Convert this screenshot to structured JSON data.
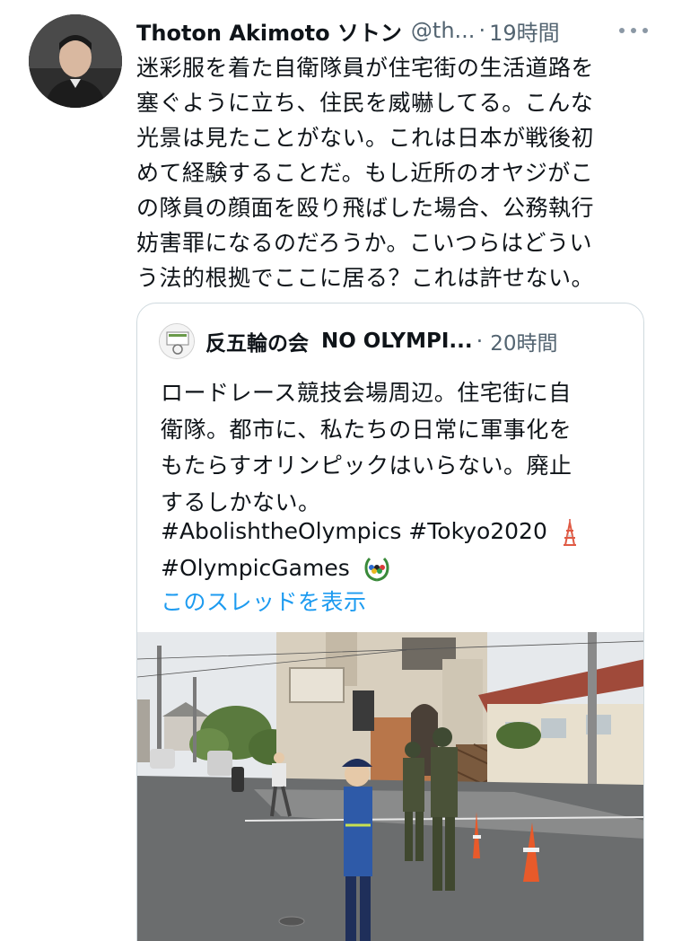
{
  "tweet": {
    "author_name": "Thoton Akimoto ソトン",
    "author_handle": "@th...",
    "separator": "·",
    "time": "19時間",
    "text_lines": [
      "迷彩服を着た自衛隊員が住宅街の生活道路を",
      "塞ぐように立ち、住民を威嚇してる。こんな",
      "光景は見たことがない。これは日本が戦後初",
      "めて経験することだ。もし近所のオヤジがこ",
      "の隊員の顔面を殴り飛ばした場合、公務執行",
      "妨害罪になるのだろうか。こいつらはどうい",
      "う法的根拠でここに居る？これは許せない。"
    ],
    "icons": {
      "more": "more-dots-icon",
      "avatar": "profile-photo"
    }
  },
  "quote": {
    "author_name": "反五輪の会",
    "author_org": "NO OLYMPI...",
    "separator": "·",
    "time": "20時間",
    "text_lines": [
      "ロードレース競技会場周辺。住宅街に自",
      "衛隊。都市に、私たちの日常に軍事化を",
      "もたらすオリンピックはいらない。廃止",
      "するしかない。"
    ],
    "hashtag_line_1": "#AbolishtheOlympics #Tokyo2020",
    "hashtag_line_2": "#OlympicGames",
    "show_thread": "このスレッドを表示",
    "icons": {
      "tower_emoji": "tokyo-tower-emoji",
      "wreath_emoji": "olympic-wreath-emoji"
    }
  },
  "colors": {
    "text": "#0f1419",
    "secondary": "#536471",
    "link": "#1d9bf0",
    "border": "#cfd9de"
  }
}
